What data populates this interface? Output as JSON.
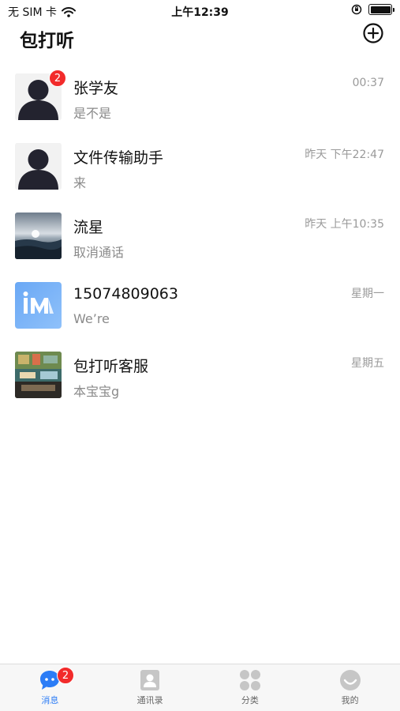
{
  "status_bar": {
    "carrier": "无 SIM 卡",
    "time": "上午12:39",
    "battery_level": 1.0
  },
  "header": {
    "title": "包打听",
    "add_icon": "plus-circle-icon"
  },
  "chats": [
    {
      "name": "张学友",
      "preview": "是不是",
      "time": "00:37",
      "unread": "2",
      "avatar": "default-person"
    },
    {
      "name": "文件传输助手",
      "preview": "来",
      "time": "昨天 下午22:47",
      "unread": "",
      "avatar": "default-person"
    },
    {
      "name": "流星",
      "preview": "取消通话",
      "time": "昨天 上午10:35",
      "unread": "",
      "avatar": "ocean-photo"
    },
    {
      "name": "15074809063",
      "preview": "We’re",
      "time": "星期一",
      "unread": "",
      "avatar": "im-logo"
    },
    {
      "name": "包打听客服",
      "preview": "本宝宝g",
      "time": "星期五",
      "unread": "",
      "avatar": "room-photo"
    }
  ],
  "tabs": [
    {
      "label": "消息",
      "icon": "chat-bubble-icon",
      "active": true,
      "badge": "2"
    },
    {
      "label": "通讯录",
      "icon": "contacts-icon",
      "active": false
    },
    {
      "label": "分类",
      "icon": "category-grid-icon",
      "active": false
    },
    {
      "label": "我的",
      "icon": "profile-icon",
      "active": false
    }
  ],
  "colors": {
    "accent": "#2b7cf6",
    "badge": "#f22b2b",
    "secondary_text": "#8a8a8a",
    "tab_bar_bg": "#f7f7f7"
  }
}
